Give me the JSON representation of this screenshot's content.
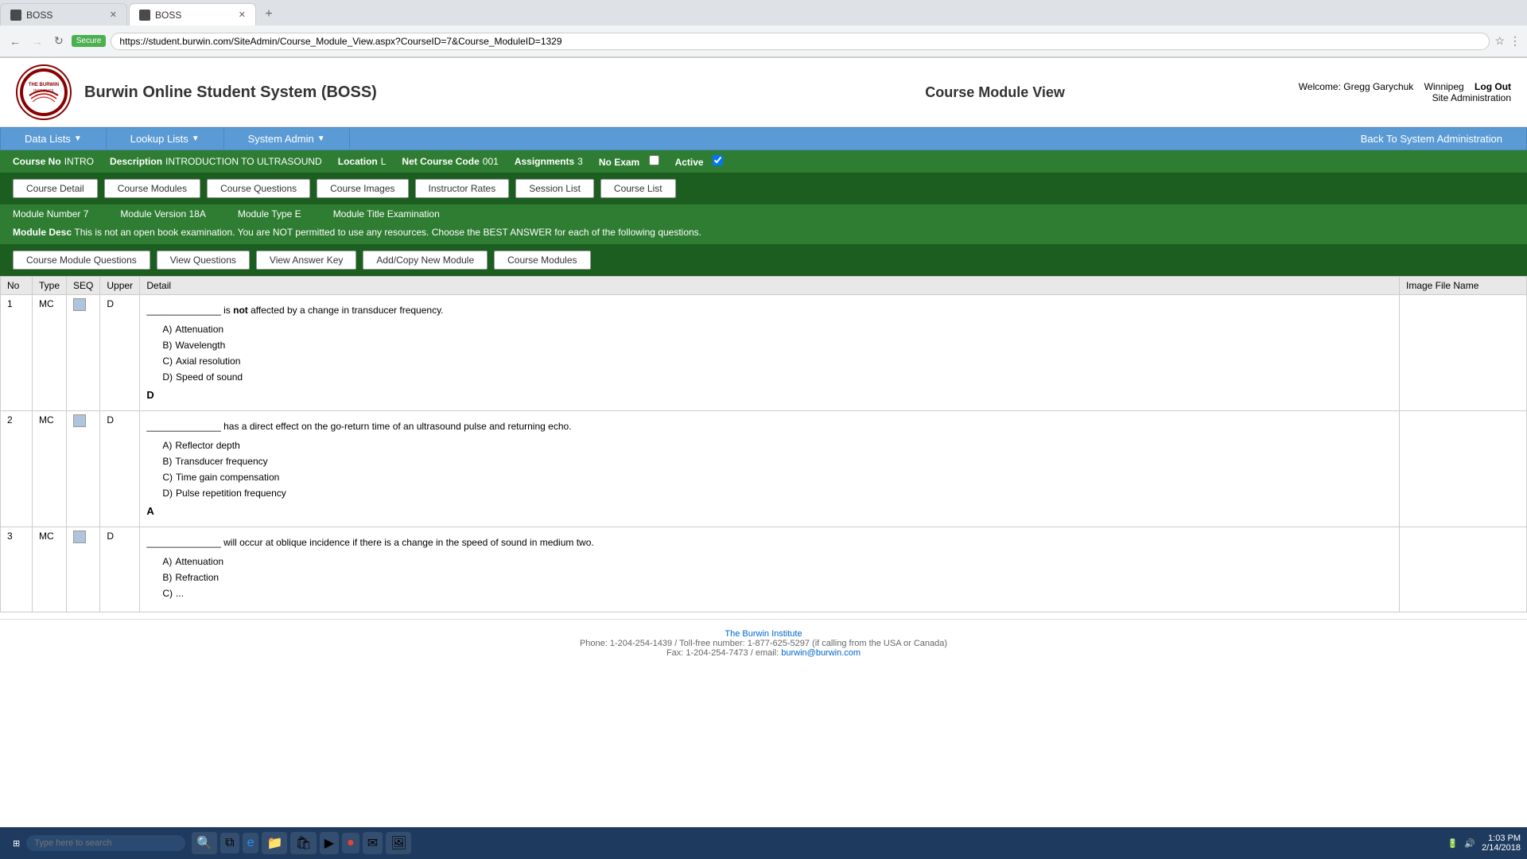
{
  "browser": {
    "tabs": [
      {
        "id": "tab1",
        "label": "BOSS",
        "active": false,
        "icon": "📄"
      },
      {
        "id": "tab2",
        "label": "BOSS",
        "active": true,
        "icon": "📄"
      }
    ],
    "url": "https://student.burwin.com/SiteAdmin/Course_Module_View.aspx?CourseID=7&Course_ModuleID=1329",
    "secure_label": "Secure"
  },
  "header": {
    "site_title": "Burwin Online Student System (BOSS)",
    "page_title": "Course Module View",
    "welcome_text": "Welcome:",
    "user_name": "Gregg Garychuk",
    "location": "Winnipeg",
    "logout_label": "Log Out",
    "site_admin_label": "Site Administration"
  },
  "nav": {
    "items": [
      {
        "label": "Data Lists",
        "has_arrow": true
      },
      {
        "label": "Lookup Lists",
        "has_arrow": true
      },
      {
        "label": "System Admin",
        "has_arrow": true
      },
      {
        "label": "Back To System Administration",
        "has_arrow": false
      }
    ]
  },
  "course_info": {
    "course_no_label": "Course No",
    "course_no_value": "INTRO",
    "description_label": "Description",
    "description_value": "INTRODUCTION TO ULTRASOUND",
    "location_label": "Location",
    "location_value": "L",
    "net_course_code_label": "Net Course Code",
    "net_course_code_value": "001",
    "assignments_label": "Assignments",
    "assignments_value": "3",
    "no_exam_label": "No Exam",
    "active_label": "Active"
  },
  "course_buttons": [
    {
      "label": "Course Detail"
    },
    {
      "label": "Course Modules"
    },
    {
      "label": "Course Questions"
    },
    {
      "label": "Course Images"
    },
    {
      "label": "Instructor Rates"
    },
    {
      "label": "Session List"
    },
    {
      "label": "Course List"
    }
  ],
  "module_info": {
    "module_number_label": "Module Number",
    "module_number_value": "7",
    "module_version_label": "Module Version",
    "module_version_value": "18A",
    "module_type_label": "Module Type",
    "module_type_value": "E",
    "module_title_label": "Module Title",
    "module_title_value": "Examination",
    "module_desc_label": "Module Desc",
    "module_desc_value": "This is not an open book examination. You are NOT permitted to use any resources. Choose the BEST ANSWER for each of the following questions."
  },
  "module_buttons": [
    {
      "label": "Course Module Questions"
    },
    {
      "label": "View Questions"
    },
    {
      "label": "View Answer Key"
    },
    {
      "label": "Add/Copy New Module"
    },
    {
      "label": "Course Modules"
    }
  ],
  "table_headers": [
    {
      "label": "No"
    },
    {
      "label": "Type"
    },
    {
      "label": "SEQ"
    },
    {
      "label": "Upper"
    },
    {
      "label": "Detail"
    },
    {
      "label": "Image File Name"
    }
  ],
  "questions": [
    {
      "no": "1",
      "type": "MC",
      "upper": "D",
      "question_prefix": "______________ is ",
      "question_bold": "not",
      "question_suffix": " affected by a change in transducer frequency.",
      "options": [
        {
          "letter": "A)",
          "text": "Attenuation"
        },
        {
          "letter": "B)",
          "text": "Wavelength"
        },
        {
          "letter": "C)",
          "text": "Axial resolution"
        },
        {
          "letter": "D)",
          "text": "Speed of sound"
        }
      ],
      "correct": "D"
    },
    {
      "no": "2",
      "type": "MC",
      "upper": "D",
      "question_prefix": "______________ has a direct effect on the go-return time of an ultrasound pulse and returning echo.",
      "question_bold": "",
      "question_suffix": "",
      "options": [
        {
          "letter": "A)",
          "text": "Reflector depth"
        },
        {
          "letter": "B)",
          "text": "Transducer frequency"
        },
        {
          "letter": "C)",
          "text": "Time gain compensation"
        },
        {
          "letter": "D)",
          "text": "Pulse repetition frequency"
        }
      ],
      "correct": "A"
    },
    {
      "no": "3",
      "type": "MC",
      "upper": "D",
      "question_prefix": "______________ will occur at oblique incidence if there is a change in the speed of sound in medium two.",
      "question_bold": "",
      "question_suffix": "",
      "options": [
        {
          "letter": "A)",
          "text": "Attenuation"
        },
        {
          "letter": "B)",
          "text": "Refraction"
        },
        {
          "letter": "C)",
          "text": "..."
        }
      ],
      "correct": ""
    }
  ],
  "footer": {
    "org": "The Burwin Institute",
    "phone": "Phone: 1-204-254-1439 / Toll-free number: 1-877-625-5297 (if calling from the USA or Canada)",
    "fax": "Fax: 1-204-254-7473 / email:",
    "email": "burwin@burwin.com"
  },
  "taskbar": {
    "search_placeholder": "Type here to search",
    "time": "1:03 PM",
    "date": "2/14/2018"
  }
}
